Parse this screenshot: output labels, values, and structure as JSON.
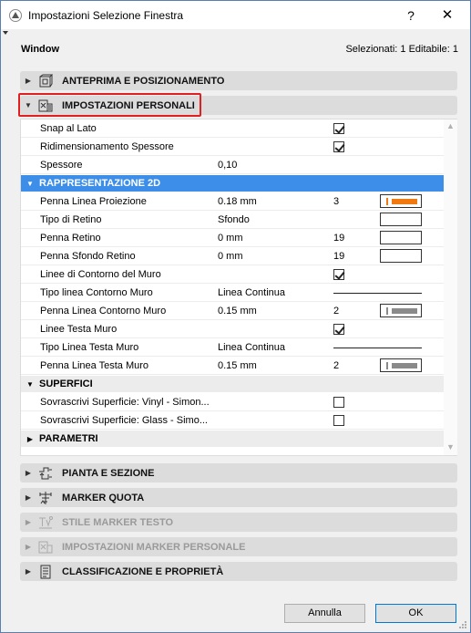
{
  "window": {
    "title": "Impostazioni Selezione Finestra",
    "help_label": "?",
    "close_label": "✕"
  },
  "header": {
    "left": "Window",
    "right": "Selezionati: 1 Editabile: 1"
  },
  "sections_top": [
    {
      "label": "ANTEPRIMA E POSIZIONAMENTO",
      "arrow": "▶",
      "icon": "preview-icon"
    },
    {
      "label": "IMPOSTAZIONI PERSONALI",
      "arrow": "▼",
      "icon": "custom-settings-icon"
    }
  ],
  "panel": {
    "rows_top": [
      {
        "name": "Snap al Lato",
        "checked": true
      },
      {
        "name": "Ridimensionamento Spessore",
        "checked": true
      },
      {
        "name": "Spessore",
        "value": "0,10"
      }
    ],
    "group_2d": {
      "label": "RAPPRESENTAZIONE 2D"
    },
    "rows_2d": [
      {
        "name": "Penna Linea Proiezione",
        "value": "0.18 mm",
        "num": "3",
        "swatch": "orange"
      },
      {
        "name": "Tipo di Retino",
        "value": "Sfondo",
        "swatch": "empty"
      },
      {
        "name": "Penna Retino",
        "value": "0 mm",
        "num": "19",
        "swatch": "empty"
      },
      {
        "name": "Penna Sfondo Retino",
        "value": "0 mm",
        "num": "19",
        "swatch": "empty"
      },
      {
        "name": "Linee di Contorno del Muro",
        "checked": true
      },
      {
        "name": "Tipo linea Contorno Muro",
        "value": "Linea Continua",
        "line": true
      },
      {
        "name": "Penna Linea Contorno Muro",
        "value": "0.15 mm",
        "num": "2",
        "swatch": "gray"
      },
      {
        "name": "Linee Testa Muro",
        "checked": true
      },
      {
        "name": "Tipo Linea Testa Muro",
        "value": "Linea Continua",
        "line": true
      },
      {
        "name": "Penna Linea Testa Muro",
        "value": "0.15 mm",
        "num": "2",
        "swatch": "gray"
      }
    ],
    "group_superfici": {
      "label": "SUPERFICI"
    },
    "rows_superfici": [
      {
        "name": "Sovrascrivi Superficie: Vinyl - Simon...",
        "checked": false
      },
      {
        "name": "Sovrascrivi Superficie: Glass - Simo...",
        "checked": false
      }
    ],
    "group_parametri": {
      "label": "PARAMETRI"
    }
  },
  "sections_bottom": [
    {
      "label": "PIANTA E SEZIONE",
      "arrow": "▶",
      "icon": "plan-section-icon",
      "enabled": true
    },
    {
      "label": "MARKER QUOTA",
      "arrow": "▶",
      "icon": "dimension-marker-icon",
      "enabled": true
    },
    {
      "label": "STILE MARKER TESTO",
      "arrow": "▶",
      "icon": "text-marker-icon",
      "enabled": false
    },
    {
      "label": "IMPOSTAZIONI MARKER PERSONALE",
      "arrow": "▶",
      "icon": "custom-marker-icon",
      "enabled": false
    },
    {
      "label": "CLASSIFICAZIONE E PROPRIETÀ",
      "arrow": "▶",
      "icon": "classification-icon",
      "enabled": true
    }
  ],
  "buttons": {
    "cancel": "Annulla",
    "ok": "OK"
  },
  "colors": {
    "accent": "#3c8ee8",
    "highlight_border": "#e02020",
    "pen_orange": "#f07a10",
    "pen_gray": "#8a8a8a"
  }
}
